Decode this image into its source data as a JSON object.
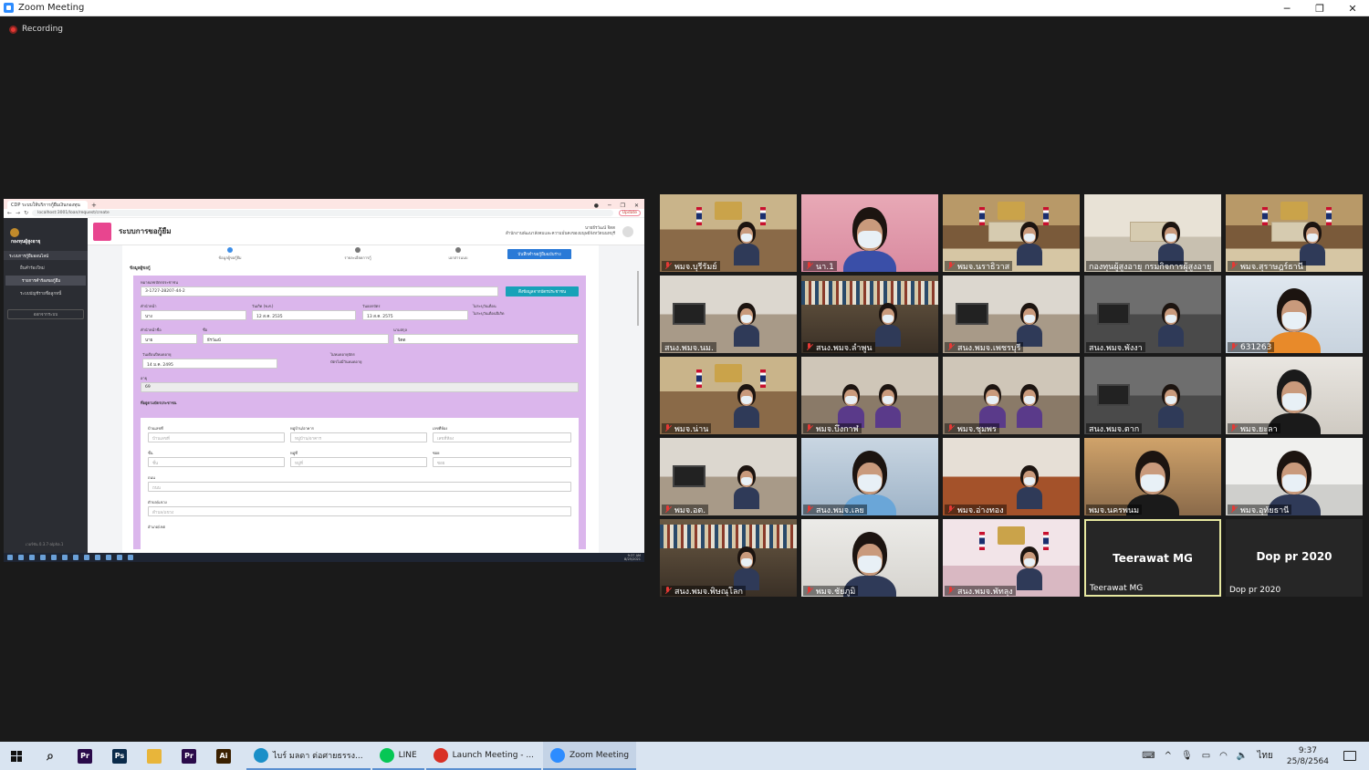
{
  "window": {
    "title": "Zoom Meeting",
    "controls": [
      "─",
      "❐",
      "✕"
    ]
  },
  "recording": {
    "label": "Recording",
    "color": "#e53935"
  },
  "shared_screen": {
    "browser": {
      "tab_title": "CDP ระบบให้บริการกู้ยืมเงินกองทุน",
      "url": "localhost:3001/loan/request/create",
      "update_label": "Update"
    },
    "sidebar": {
      "org": "กองทุนผู้สูงอายุ",
      "group": "ระบบการกู้ยืมออนไลน์",
      "items": [
        "ยื่นคำร้องใหม่",
        "รายการคำร้องขอกู้ยืม",
        "ระบบบัญชีรายชื่อลูกหนี้"
      ],
      "button": "ออกจากระบบ",
      "version": "เวอร์ชัน 0.3.7-alpha.1"
    },
    "header": {
      "title": "ระบบการขอกู้ยืม",
      "user_line1": "นายธีรวัฒน์ จิตต",
      "user_line2": "สำนักงานพัฒนาสังคมและความมั่นคงของมนุษย์จังหวัดนนทบุรี"
    },
    "steps": [
      "ข้อมูลผู้ขอกู้ยืม",
      "รายละเอียดการกู้",
      "เอกสารแนบ"
    ],
    "save_button": "บันทึกคำขอกู้ยืมฉบับร่าง",
    "section_label": "ข้อมูลผู้ขอกู้",
    "form": {
      "id_label": "หมายเลขบัตรประชาชน",
      "id_value": "3-1727-28207-44-2",
      "fetch_button": "ดึงข้อมูลจากบัตรประชาชน",
      "title_label": "คำนำหน้า",
      "title_value": "นาง",
      "dob_label": "วันเกิด (พ.ศ.)",
      "dob_value": "12 ส.ค. 2535",
      "issue_label": "วันออกบัตร",
      "issue_value": "13 ส.ค. 2575",
      "nodate_label": "ไม่ระบุวันเดือน",
      "nodate_check": "ไม่ระบุวันเดือนปีเกิด",
      "prefix_label": "คำนำหน้าชื่อ",
      "prefix_value": "นาย",
      "name_label": "ชื่อ",
      "name_value": "ธีรวัฒน์",
      "surname_label": "นามสกุล",
      "surname_value": "จิตต",
      "expire_label": "วันเดือนปีหมดอายุ",
      "expire_value": "14 ม.ค. 2495",
      "noexpire_label": "ไม่หมดอายุบัตร",
      "noexpire_check": "บัตรไม่มีวันหมดอายุ",
      "age_label": "อายุ",
      "age_value": "69",
      "address_label": "ที่อยู่ตามบัตรประชาชน",
      "house_label": "บ้านเลขที่",
      "house_ph": "บ้านเลขที่",
      "village_label": "หมู่บ้าน/อาคาร",
      "village_ph": "หมู่บ้าน/อาคาร",
      "room_label": "เลขที่ห้อง",
      "room_ph": "เลขที่ห้อง",
      "floor_label": "ชั้น",
      "floor_ph": "ชั้น",
      "moo_label": "หมู่ที่",
      "moo_ph": "หมู่ที่",
      "soi_label": "ซอย",
      "soi_ph": "ซอย",
      "road_label": "ถนน",
      "road_ph": "ถนน",
      "subdistrict_label": "ตำบล/แขวง",
      "subdistrict_ph": "ตำบล/แขวง",
      "district_label": "อำเภอ/เขต"
    },
    "taskbar_time": "9:37 AM",
    "taskbar_date": "8/25/2021"
  },
  "participants": [
    {
      "name": "พมจ.บุรีรัมย์",
      "muted": true,
      "scene": "office-plaque"
    },
    {
      "name": "นา.1",
      "muted": true,
      "scene": "closeup-pink"
    },
    {
      "name": "พมจ.นราธิวาส",
      "muted": true,
      "scene": "meeting-room"
    },
    {
      "name": "กองทุนผู้สูงอายุ กรมกิจการผู้สูงอายุ",
      "muted": false,
      "scene": "conference"
    },
    {
      "name": "พมจ.สุราษฎร์ธานี",
      "muted": true,
      "scene": "meeting-room"
    },
    {
      "name": "สนง.พมจ.นม.",
      "muted": false,
      "scene": "office"
    },
    {
      "name": "สนง.พมจ.ลำพูน",
      "muted": true,
      "scene": "shelves"
    },
    {
      "name": "สนง.พมจ.เพชรบุรี",
      "muted": true,
      "scene": "office"
    },
    {
      "name": "สนง.พมจ.พังงา",
      "muted": false,
      "scene": "office-dark"
    },
    {
      "name": "631263",
      "muted": true,
      "scene": "orange-shirt"
    },
    {
      "name": "พมจ.น่าน",
      "muted": true,
      "scene": "office-plaque"
    },
    {
      "name": "พมจ.บึงกาฬ",
      "muted": true,
      "scene": "two-people"
    },
    {
      "name": "พมจ.ชุมพร",
      "muted": true,
      "scene": "two-people"
    },
    {
      "name": "สนง.พมจ.ตาก",
      "muted": false,
      "scene": "office-dark"
    },
    {
      "name": "พมจ.ยะลา",
      "muted": true,
      "scene": "hijab"
    },
    {
      "name": "พมจ.อต.",
      "muted": true,
      "scene": "office"
    },
    {
      "name": "สนง.พมจ.เลย",
      "muted": true,
      "scene": "closeup-blue"
    },
    {
      "name": "พมจ.อ่างทอง",
      "muted": true,
      "scene": "wood"
    },
    {
      "name": "พมจ.นครพนม",
      "muted": false,
      "scene": "closeup"
    },
    {
      "name": "พมจ.อุทัยธานี",
      "muted": true,
      "scene": "closeup-dark"
    },
    {
      "name": "สนง.พมจ.พิษณุโลก",
      "muted": true,
      "scene": "shelves"
    },
    {
      "name": "พมจ.ชัยภูมิ",
      "muted": true,
      "scene": "white-wall"
    },
    {
      "name": "สนง.พมจ.พัทลุง",
      "muted": true,
      "scene": "service-center"
    },
    {
      "name": "Teerawat MG",
      "muted": false,
      "scene": "no-video",
      "active": true
    },
    {
      "name": "Dop pr 2020",
      "muted": false,
      "scene": "no-video"
    }
  ],
  "taskbar": {
    "icons": [
      {
        "name": "search-icon",
        "glyph": "⌕",
        "color": "#222222"
      },
      {
        "name": "premiere-icon",
        "glyph": "Pr",
        "color": "#2a0a4a"
      },
      {
        "name": "photoshop-icon",
        "glyph": "Ps",
        "color": "#0a2a4a"
      },
      {
        "name": "folder-icon",
        "glyph": "",
        "color": "#e8b53a"
      },
      {
        "name": "premiere-icon-2",
        "glyph": "Pr",
        "color": "#2a0a4a"
      },
      {
        "name": "illustrator-icon",
        "glyph": "Ai",
        "color": "#3a2000"
      }
    ],
    "apps": [
      {
        "name": "edge-app",
        "label": "ไบร์ มลดา ต่อศายธรรง...",
        "color": "#1a8fc8",
        "selected": false
      },
      {
        "name": "line-app",
        "label": "LINE",
        "color": "#06c755",
        "selected": false
      },
      {
        "name": "chrome-app",
        "label": "Launch Meeting - ...",
        "color": "#d93025",
        "selected": false
      },
      {
        "name": "zoom-app",
        "label": "Zoom Meeting",
        "color": "#2d8cff",
        "selected": true
      }
    ],
    "time": "9:37",
    "date": "25/8/2564",
    "lang": "ไทย"
  }
}
